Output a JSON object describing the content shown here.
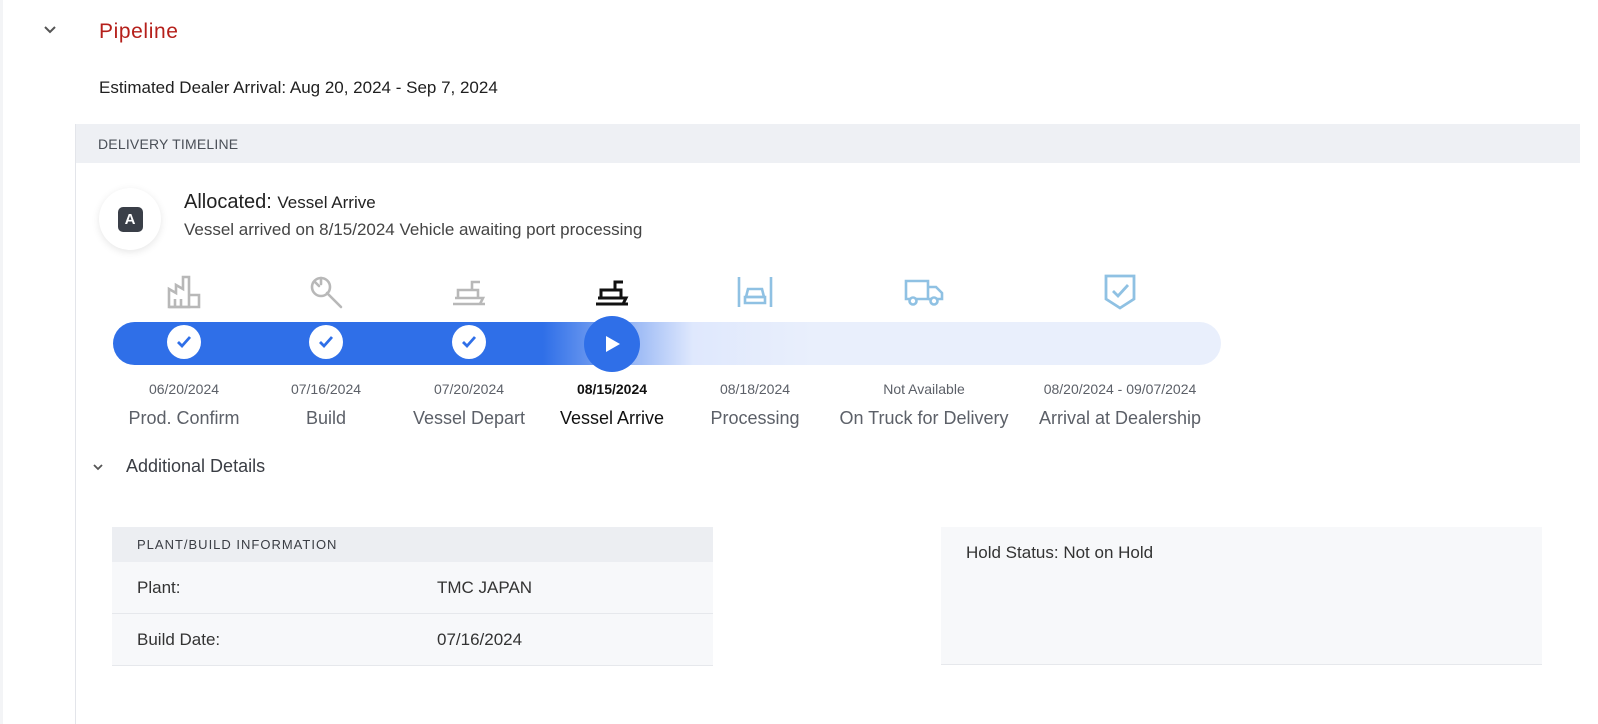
{
  "section": {
    "title": "Pipeline"
  },
  "eta": {
    "text": "Estimated Dealer Arrival: Aug 20, 2024 - Sep 7, 2024"
  },
  "timeline": {
    "header": "DELIVERY TIMELINE",
    "badge_letter": "A",
    "status_prefix": "Allocated:",
    "status_value": "Vessel Arrive",
    "status_detail": "Vessel arrived on 8/15/2024 Vehicle awaiting port processing",
    "progress_fraction": 0.45,
    "stages": [
      {
        "date": "06/20/2024",
        "label": "Prod. Confirm",
        "state": "done",
        "icon": "factory-icon"
      },
      {
        "date": "07/16/2024",
        "label": "Build",
        "state": "done",
        "icon": "wrench-icon"
      },
      {
        "date": "07/20/2024",
        "label": "Vessel Depart",
        "state": "done",
        "icon": "ship-icon"
      },
      {
        "date": "08/15/2024",
        "label": "Vessel Arrive",
        "state": "current",
        "icon": "ship-icon"
      },
      {
        "date": "08/18/2024",
        "label": "Processing",
        "state": "pending",
        "icon": "car-processing-icon"
      },
      {
        "date": "Not Available",
        "label": "On Truck for Delivery",
        "state": "pending",
        "icon": "truck-icon"
      },
      {
        "date": "08/20/2024 - 09/07/2024",
        "label": "Arrival at Dealership",
        "state": "pending",
        "icon": "shield-check-icon"
      }
    ]
  },
  "details": {
    "toggle_label": "Additional Details",
    "plant_table": {
      "header": "PLANT/BUILD INFORMATION",
      "rows": [
        {
          "key": "Plant:",
          "value": "TMC JAPAN"
        },
        {
          "key": "Build Date:",
          "value": "07/16/2024"
        }
      ]
    },
    "hold_status": "Hold Status: Not on Hold"
  },
  "colors": {
    "accent": "#2f6fe8",
    "title_red": "#b5201b",
    "icon_gray": "#b8b8b8",
    "icon_blue": "#8fc1e3"
  }
}
